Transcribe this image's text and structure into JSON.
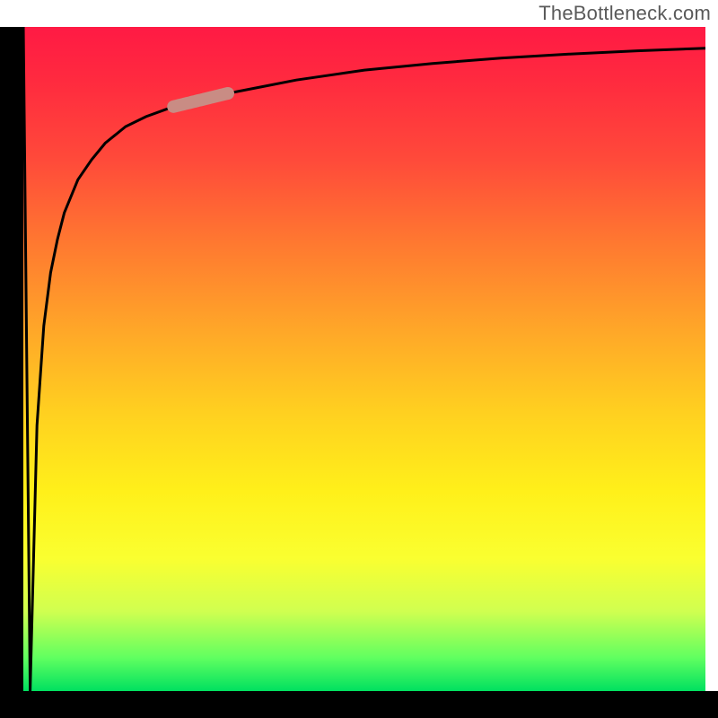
{
  "watermark": "TheBottleneck.com",
  "colors": {
    "gradient_top": "#ff1a44",
    "gradient_mid1": "#ff7a30",
    "gradient_mid2": "#fff01a",
    "gradient_bottom": "#00e060",
    "curve": "#000000",
    "accent_segment": "#c98c84",
    "axes": "#000000"
  },
  "chart_data": {
    "type": "line",
    "title": "",
    "xlabel": "",
    "ylabel": "",
    "xlim": [
      0,
      100
    ],
    "ylim": [
      0,
      100
    ],
    "grid": false,
    "legend": false,
    "series": [
      {
        "name": "main-curve",
        "x": [
          0,
          1,
          2,
          3,
          4,
          5,
          6,
          8,
          10,
          12,
          15,
          18,
          22,
          26,
          30,
          35,
          40,
          50,
          60,
          70,
          80,
          90,
          100
        ],
        "y": [
          100,
          0,
          40,
          55,
          63,
          68,
          72,
          77,
          80,
          82.5,
          85,
          86.5,
          88,
          89,
          90,
          91,
          92,
          93.5,
          94.5,
          95.3,
          95.9,
          96.4,
          96.8
        ]
      }
    ],
    "accent_segment": {
      "x_start": 22,
      "x_end": 30
    },
    "annotations": []
  }
}
